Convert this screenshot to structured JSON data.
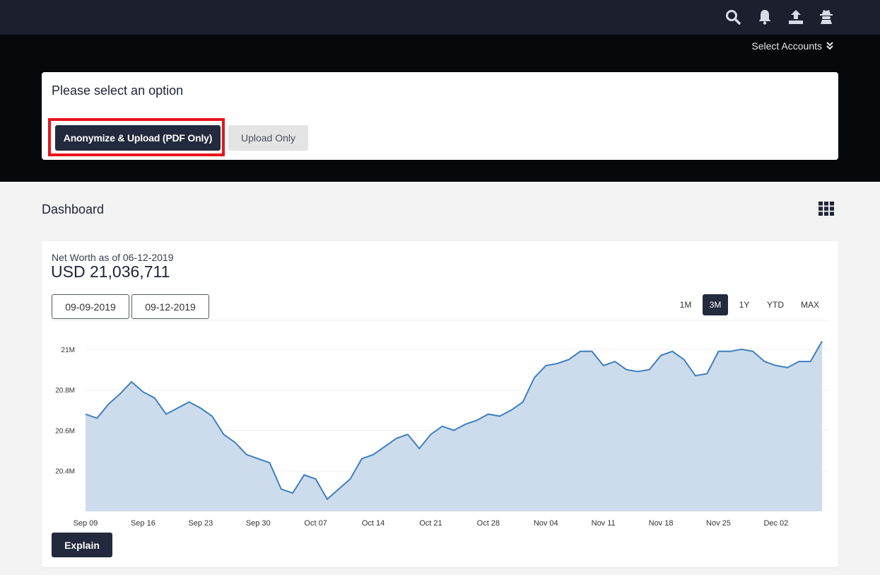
{
  "header": {
    "icons": [
      "search-icon",
      "bell-icon",
      "upload-icon",
      "spy-icon"
    ],
    "select_accounts_label": "Select Accounts"
  },
  "option_panel": {
    "title": "Please select an option",
    "primary_button": "Anonymize & Upload (PDF Only)",
    "secondary_button": "Upload Only"
  },
  "dashboard": {
    "title": "Dashboard"
  },
  "net_worth": {
    "label": "Net Worth as of 06-12-2019",
    "value": "USD 21,036,711",
    "start_date": "09-09-2019",
    "end_date": "09-12-2019",
    "ranges": [
      "1M",
      "3M",
      "1Y",
      "YTD",
      "MAX"
    ],
    "active_range": "3M",
    "explain_button": "Explain"
  },
  "colors": {
    "line": "#3f7fbf",
    "area": "#cddcec",
    "primary": "#232a3d",
    "highlight": "#e8141c"
  },
  "chart_data": {
    "type": "area",
    "ylabel": "",
    "xlabel": "",
    "ylim": [
      20.2,
      21.15
    ],
    "yticks": [
      20.4,
      20.6,
      20.8,
      21.0
    ],
    "ytick_labels": [
      "20.4M",
      "20.6M",
      "20.8M",
      "21M"
    ],
    "xtick_labels": [
      "Sep 09",
      "Sep 16",
      "Sep 23",
      "Sep 30",
      "Oct 07",
      "Oct 14",
      "Oct 21",
      "Oct 28",
      "Nov 04",
      "Nov 11",
      "Nov 18",
      "Nov 25",
      "Dec 02"
    ],
    "series": [
      {
        "values": [
          20.68,
          20.66,
          20.73,
          20.78,
          20.84,
          20.79,
          20.76,
          20.68,
          20.71,
          20.74,
          20.71,
          20.67,
          20.58,
          20.54,
          20.48,
          20.46,
          20.44,
          20.31,
          20.29,
          20.38,
          20.36,
          20.26,
          20.31,
          20.36,
          20.46,
          20.48,
          20.52,
          20.56,
          20.58,
          20.51,
          20.58,
          20.62,
          20.6,
          20.63,
          20.65,
          20.68,
          20.67,
          20.7,
          20.74,
          20.86,
          20.92,
          20.93,
          20.95,
          20.99,
          20.99,
          20.92,
          20.94,
          20.9,
          20.89,
          20.9,
          20.97,
          20.99,
          20.95,
          20.87,
          20.88,
          20.99,
          20.99,
          21.0,
          20.99,
          20.94,
          20.92,
          20.91,
          20.94,
          20.94,
          21.04
        ]
      }
    ]
  }
}
